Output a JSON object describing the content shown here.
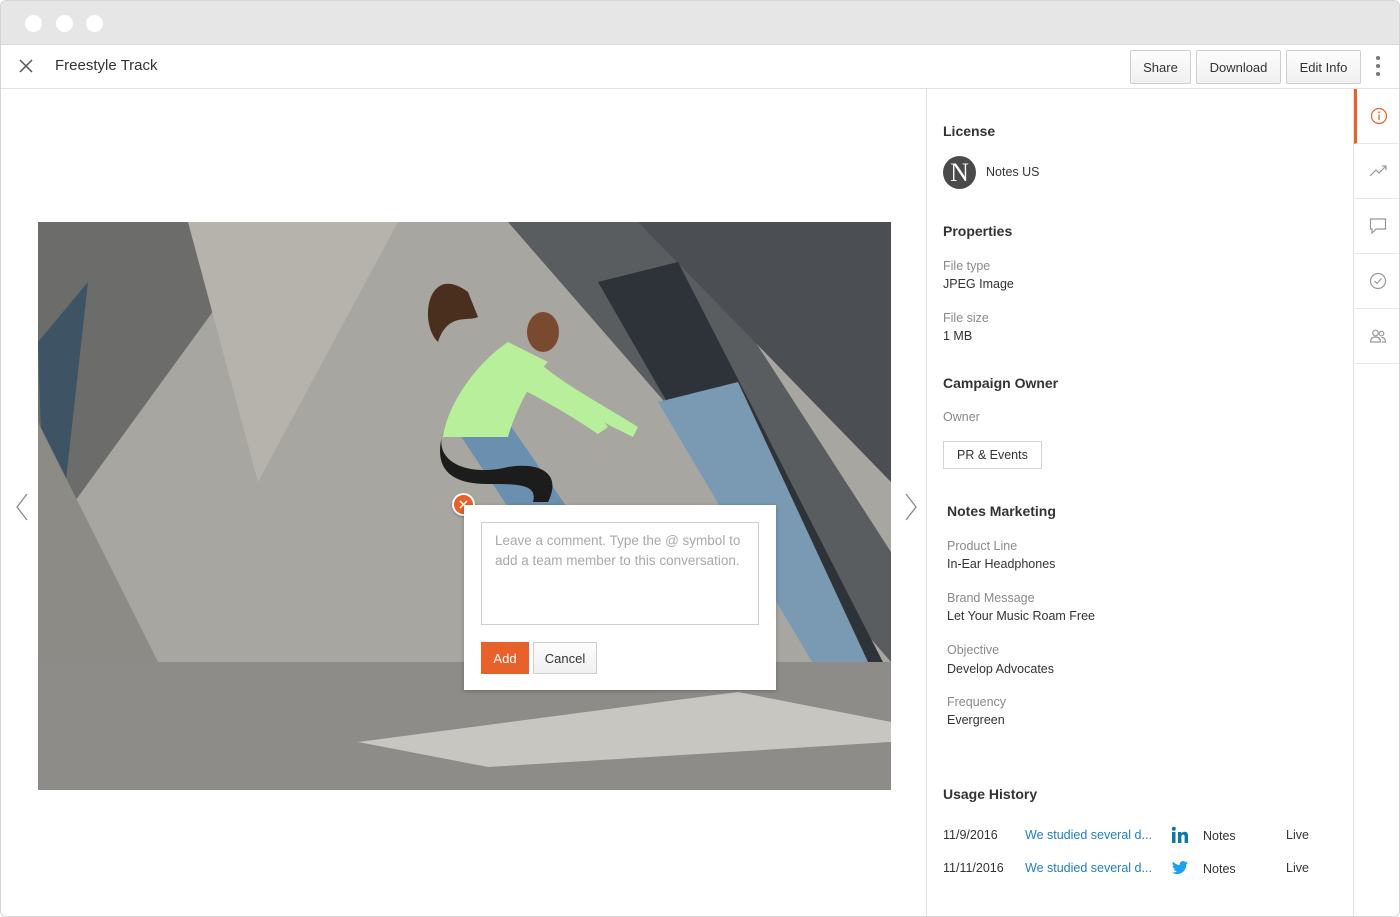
{
  "header": {
    "title": "Freestyle Track",
    "share_label": "Share",
    "download_label": "Download",
    "edit_label": "Edit Info"
  },
  "comment": {
    "placeholder": "Leave a comment. Type the @ symbol to add a team member to this conversation.",
    "add_label": "Add",
    "cancel_label": "Cancel"
  },
  "panel": {
    "license": {
      "heading": "License",
      "name": "Notes US",
      "logo_letter": "N"
    },
    "properties": {
      "heading": "Properties",
      "file_type_label": "File type",
      "file_type": "JPEG Image",
      "file_size_label": "File size",
      "file_size": "1 MB"
    },
    "campaign_owner": {
      "heading": "Campaign Owner",
      "owner_label": "Owner",
      "owner": "PR & Events"
    },
    "marketing": {
      "heading": "Notes Marketing",
      "product_line_label": "Product Line",
      "product_line": "In-Ear Headphones",
      "brand_message_label": "Brand Message",
      "brand_message": "Let Your Music Roam Free",
      "objective_label": "Objective",
      "objective": "Develop Advocates",
      "frequency_label": "Frequency",
      "frequency": "Evergreen"
    },
    "usage": {
      "heading": "Usage History",
      "rows": [
        {
          "date": "11/9/2016",
          "link": "We studied several d...",
          "network": "linkedin-icon",
          "account": "Notes",
          "status": "Live"
        },
        {
          "date": "11/11/2016",
          "link": "We studied several d...",
          "network": "twitter-icon",
          "account": "Notes",
          "status": "Live"
        }
      ]
    }
  },
  "rail": {
    "icons": [
      "info-icon",
      "trend-icon",
      "comment-icon",
      "check-circle-icon",
      "people-icon"
    ],
    "active": "info-icon"
  },
  "colors": {
    "accent": "#e8612b",
    "link": "#1f7fc4",
    "linkedin": "#0e76a8",
    "twitter": "#1da1f2"
  }
}
